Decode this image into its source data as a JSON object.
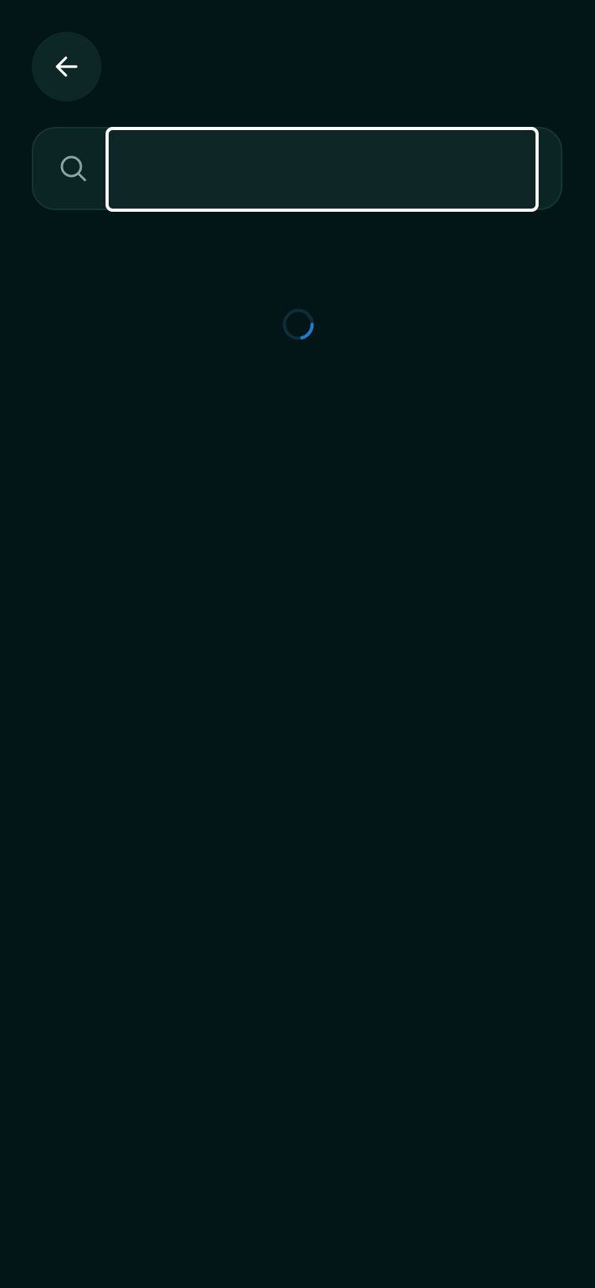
{
  "header": {
    "back_icon": "arrow-left-icon"
  },
  "search": {
    "icon": "search-icon",
    "value": "",
    "placeholder": ""
  },
  "loading": {
    "icon": "loading-spinner-icon"
  },
  "colors": {
    "background": "#021517",
    "surface": "#0b2424",
    "back_button": "#0d2626",
    "focus_border": "#ffffff",
    "spinner_track": "#0d2e3a",
    "spinner_accent": "#1f7ad1",
    "icon_muted": "#8ea3a6"
  }
}
